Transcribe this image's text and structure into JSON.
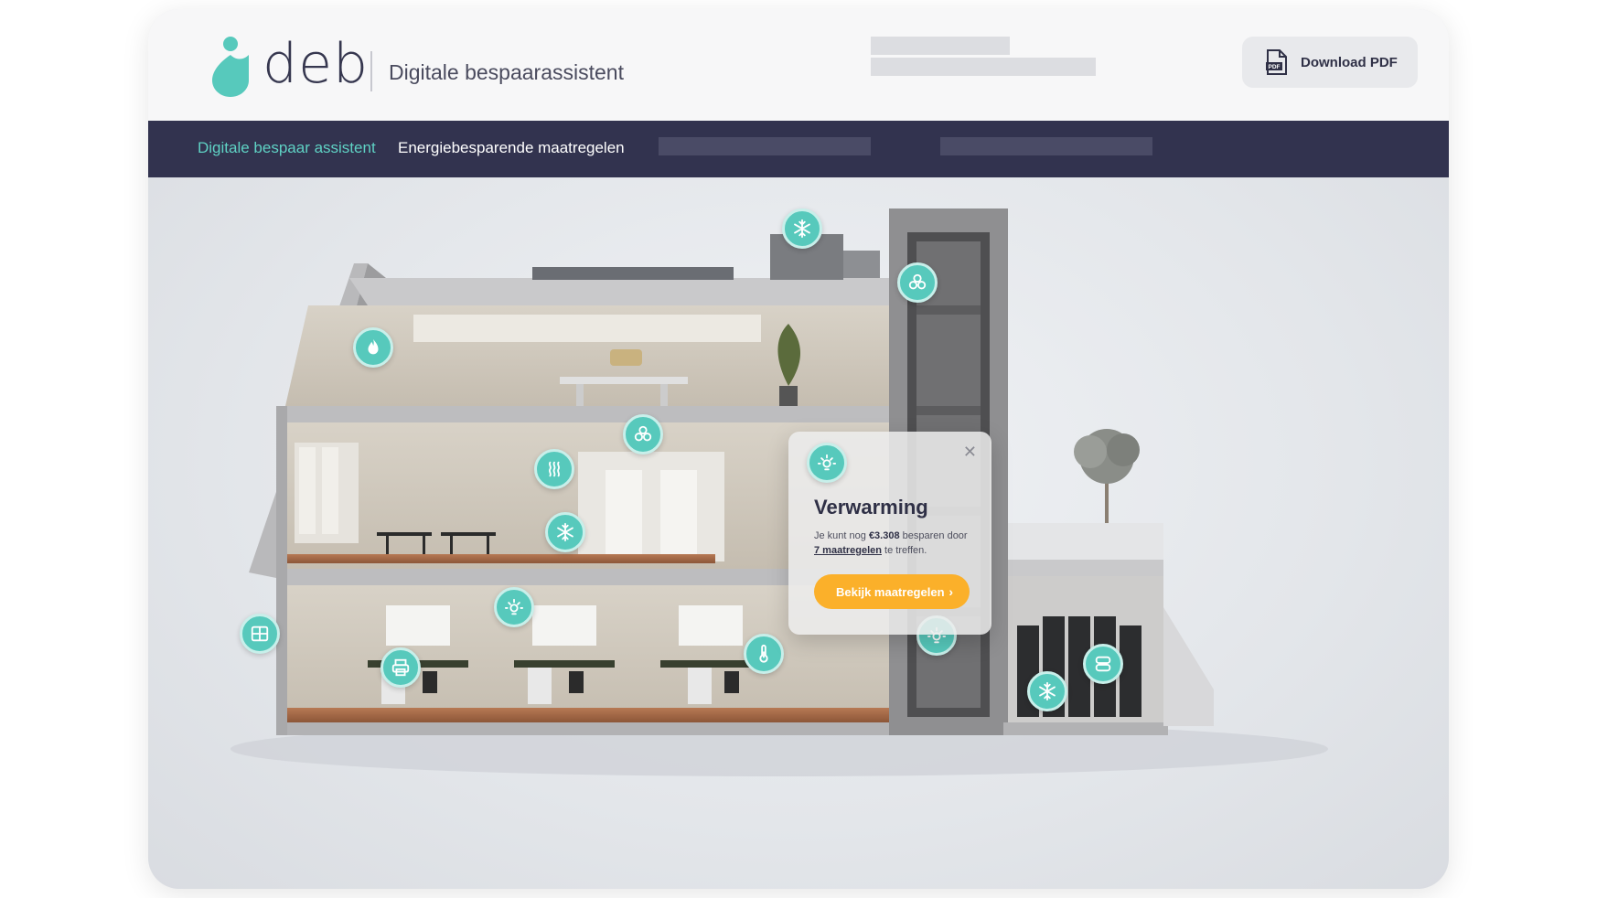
{
  "header": {
    "logo_text": "deb",
    "subtitle": "Digitale bespaarassistent",
    "download_label": "Download PDF",
    "pdf_icon_text": "PDF"
  },
  "nav": {
    "items": [
      {
        "label": "Digitale bespaar assistent",
        "active": true
      },
      {
        "label": "Energiebesparende maatregelen",
        "active": false
      }
    ]
  },
  "popup": {
    "title": "Verwarming",
    "text_prefix": "Je kunt nog ",
    "amount": "€3.308",
    "text_middle": " besparen door",
    "link": "7 maatregelen",
    "text_suffix": " te treffen.",
    "button_label": "Bekijk maatregelen",
    "close_symbol": "✕",
    "icon": "lightbulb-icon"
  },
  "hotspots": [
    {
      "name": "cooling",
      "icon": "snowflake-icon"
    },
    {
      "name": "ventilation",
      "icon": "fan-icon"
    },
    {
      "name": "gas",
      "icon": "flame-icon"
    },
    {
      "name": "ventilation",
      "icon": "fan-icon"
    },
    {
      "name": "heating",
      "icon": "heat-waves-icon"
    },
    {
      "name": "cooling",
      "icon": "snowflake-icon"
    },
    {
      "name": "lighting",
      "icon": "lightbulb-icon"
    },
    {
      "name": "facade",
      "icon": "window-grid-icon"
    },
    {
      "name": "office-equipment",
      "icon": "printer-icon"
    },
    {
      "name": "temperature",
      "icon": "thermometer-icon"
    },
    {
      "name": "lighting",
      "icon": "lightbulb-icon"
    },
    {
      "name": "cooling",
      "icon": "snowflake-icon"
    },
    {
      "name": "servers",
      "icon": "server-icon"
    }
  ],
  "colors": {
    "brand_teal": "#57c9bc",
    "nav_bg": "#32334f",
    "nav_active": "#5fd2c4",
    "cta_orange": "#fbb02a",
    "text_dark": "#2f3046"
  }
}
